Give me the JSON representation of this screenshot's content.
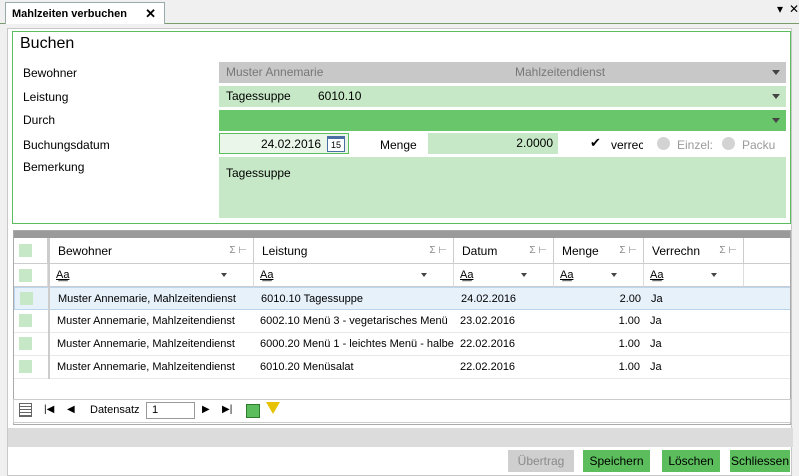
{
  "tab": {
    "title": "Mahlzeiten verbuchen",
    "close": "✕",
    "pin": "▾",
    "close_all": "✕"
  },
  "form": {
    "group_title": "Buchen",
    "bewohner_label": "Bewohner",
    "bewohner_value": "Muster Annemarie",
    "bewohner_dienst": "Mahlzeitendienst",
    "leistung_label": "Leistung",
    "leistung_name": "Tagessuppe",
    "leistung_code": "6010.10",
    "durch_label": "Durch",
    "durch_value": "",
    "buchungsdatum_label": "Buchungsdatum",
    "buchungsdatum_value": "24.02.2016",
    "calendar_day": "15",
    "menge_label": "Menge",
    "menge_value": "2.0000",
    "verrec_label": "verrec",
    "einzel_label": "Einzel:",
    "packu_label": "Packu",
    "bemerkung_label": "Bemerkung",
    "bemerkung_value": "Tagessuppe"
  },
  "grid": {
    "columns": [
      "Bewohner",
      "Leistung",
      "Datum",
      "Menge",
      "Verrechn"
    ],
    "filter_text": "A͟a",
    "rows": [
      {
        "bewohner": "Muster Annemarie, Mahlzeitendienst",
        "leistung": "6010.10 Tagessuppe",
        "datum": "24.02.2016",
        "menge": "2.00",
        "verrechn": "Ja"
      },
      {
        "bewohner": "Muster Annemarie, Mahlzeitendienst",
        "leistung": "6002.10 Menü 3 - vegetarisches Menü",
        "datum": "23.02.2016",
        "menge": "1.00",
        "verrechn": "Ja"
      },
      {
        "bewohner": "Muster Annemarie, Mahlzeitendienst",
        "leistung": "6000.20 Menü 1 - leichtes Menü - halbe",
        "datum": "22.02.2016",
        "menge": "1.00",
        "verrechn": "Ja"
      },
      {
        "bewohner": "Muster Annemarie, Mahlzeitendienst",
        "leistung": "6010.20 Menüsalat",
        "datum": "22.02.2016",
        "menge": "1.00",
        "verrechn": "Ja"
      }
    ]
  },
  "pager": {
    "label": "Datensatz",
    "value": "1"
  },
  "buttons": {
    "uebertrag": "Übertrag",
    "speichern": "Speichern",
    "loeschen": "Löschen",
    "schliessen": "Schliessen"
  }
}
